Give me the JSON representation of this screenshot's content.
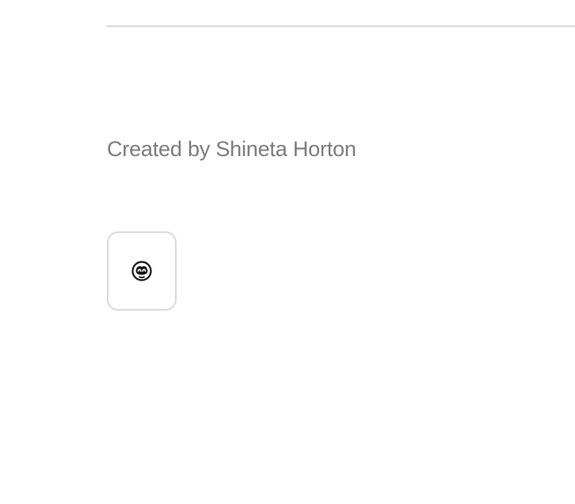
{
  "credit": {
    "text": "Created by Shineta Horton"
  },
  "author_card": {
    "icon": "monkey-face-icon"
  },
  "colors": {
    "divider": "#d8d8d8",
    "credit_text": "#7a7a7a",
    "card_border": "#d9d9d9",
    "icon": "#111111"
  }
}
